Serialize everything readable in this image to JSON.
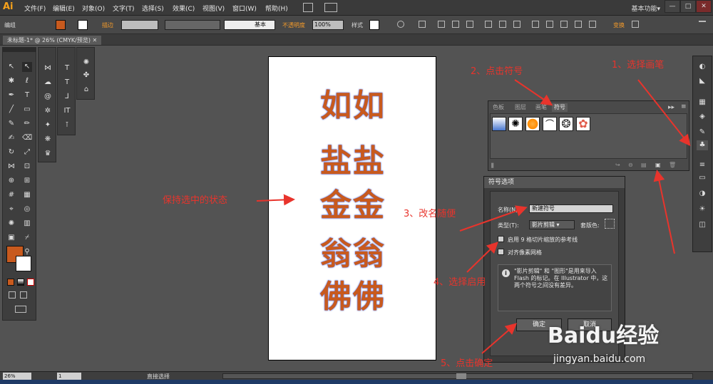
{
  "app": {
    "logo": "Ai",
    "workspace": "基本功能",
    "workspace_arrow": "▾"
  },
  "menu": [
    "文件(F)",
    "编辑(E)",
    "对象(O)",
    "文字(T)",
    "选择(S)",
    "效果(C)",
    "视图(V)",
    "窗口(W)",
    "帮助(H)"
  ],
  "window_buttons": [
    "—",
    "□",
    "✕"
  ],
  "control_bar": {
    "mode": "编组",
    "stroke_label": "描边",
    "stroke_style": "基本",
    "opacity_label": "不透明度",
    "opacity_value": "100%",
    "style_label": "样式",
    "transform_label": "变换"
  },
  "document": {
    "title": "未标题-1* @ 26% (CMYK/预览)",
    "close": "✕"
  },
  "artboard_text": [
    "如如",
    "盐盐",
    "金金",
    "翁翁",
    "佛佛"
  ],
  "symbols_panel": {
    "tabs": [
      "色板",
      "图层",
      "画笔",
      "符号"
    ],
    "active_tab": "符号"
  },
  "dialog": {
    "title": "符号选项",
    "name_label": "名称(N):",
    "name_value": "新建符号",
    "type_label": "类型(T):",
    "type_value": "影片剪辑",
    "registration_label": "套版色:",
    "enable_9slice": "启用 9 格切片缩放的参考线",
    "align_pixel": "对齐像素网格",
    "info_text": "\"影片剪辑\" 和 \"图形\"是用来导入 Flash 的标记。在 Illustrator 中，这两个符号之间没有差异。",
    "ok": "确定",
    "cancel": "取消",
    "info_icon": "i"
  },
  "annotations": {
    "a1": "1、选择画笔",
    "a2": "2、点击符号",
    "a3": "3、改名随便",
    "a4": "4、选择启用",
    "a5": "5、点击确定",
    "keep": "保持选中的状态"
  },
  "status": {
    "zoom": "26%",
    "page": "1",
    "tool": "直接选择"
  },
  "watermark": {
    "brand": "Baidu经验",
    "url": "jingyan.baidu.com"
  },
  "colors": {
    "fill": "#c85a1e",
    "accent": "#f39a2a",
    "annotation": "#e8342c"
  }
}
